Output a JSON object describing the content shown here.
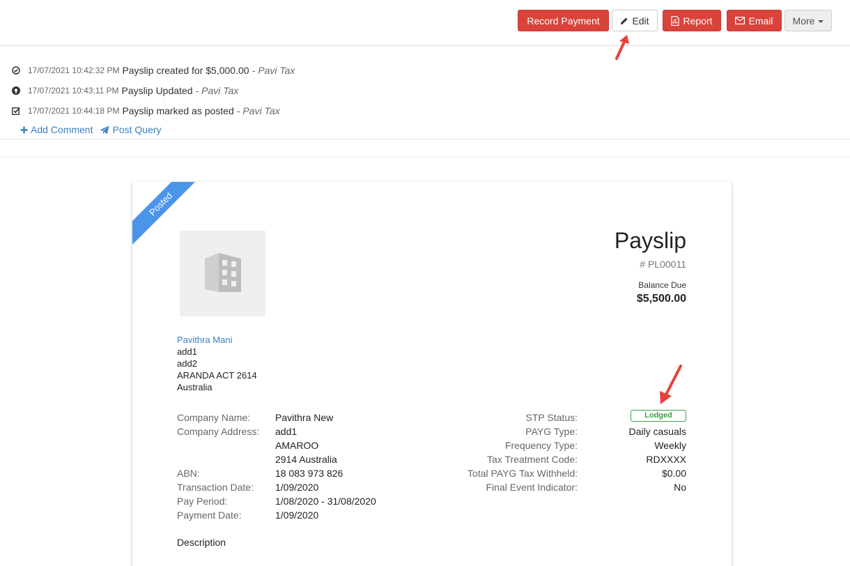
{
  "toolbar": {
    "record_payment": "Record Payment",
    "edit": "Edit",
    "report": "Report",
    "email": "Email",
    "more": "More"
  },
  "activity": [
    {
      "time": "17/07/2021 10:42:32 PM",
      "text": "Payslip created for $5,000.00",
      "sep": "-",
      "user": "Pavi Tax",
      "icon": "clock-check-icon"
    },
    {
      "time": "17/07/2021 10:43:11 PM",
      "text": "Payslip Updated",
      "sep": "-",
      "user": "Pavi Tax",
      "icon": "arrow-up-circle-icon"
    },
    {
      "time": "17/07/2021 10:44:18 PM",
      "text": "Payslip marked as posted",
      "sep": "-",
      "user": "Pavi Tax",
      "icon": "checkbox-checked-icon"
    }
  ],
  "links": {
    "add_comment": "Add Comment",
    "post_query": "Post Query"
  },
  "document": {
    "ribbon": "Posted",
    "title": "Payslip",
    "number": "# PL00011",
    "balance_label": "Balance Due",
    "balance_value": "$5,500.00",
    "employee": {
      "name": "Pavithra Mani",
      "line1": "add1",
      "line2": "add2",
      "line3": "ARANDA ACT 2614",
      "line4": "Australia"
    },
    "details_left": {
      "company_name_label": "Company Name:",
      "company_name": "Pavithra New",
      "company_address_label": "Company Address:",
      "company_address_1": "add1",
      "company_address_2": "AMAROO",
      "company_address_3": "2914 Australia",
      "abn_label": "ABN:",
      "abn": "18 083 973 826",
      "transaction_date_label": "Transaction Date:",
      "transaction_date": "1/09/2020",
      "pay_period_label": "Pay Period:",
      "pay_period": "1/08/2020 - 31/08/2020",
      "payment_date_label": "Payment Date:",
      "payment_date": "1/09/2020"
    },
    "details_right": {
      "stp_status_label": "STP Status:",
      "stp_status": "Lodged",
      "payg_type_label": "PAYG Type:",
      "payg_type": "Daily casuals",
      "frequency_type_label": "Frequency Type:",
      "frequency_type": "Weekly",
      "tax_treatment_label": "Tax Treatment Code:",
      "tax_treatment": "RDXXXX",
      "total_payg_label": "Total PAYG Tax Withheld:",
      "total_payg": "$0.00",
      "final_event_label": "Final Event Indicator:",
      "final_event": "No"
    },
    "description_label": "Description"
  },
  "colors": {
    "primary_red": "#d9433a",
    "link_blue": "#3a7fc1",
    "ribbon_blue": "#4a94ea",
    "lodged_green": "#3aa04a",
    "annotation_arrow": "#e8413b"
  }
}
